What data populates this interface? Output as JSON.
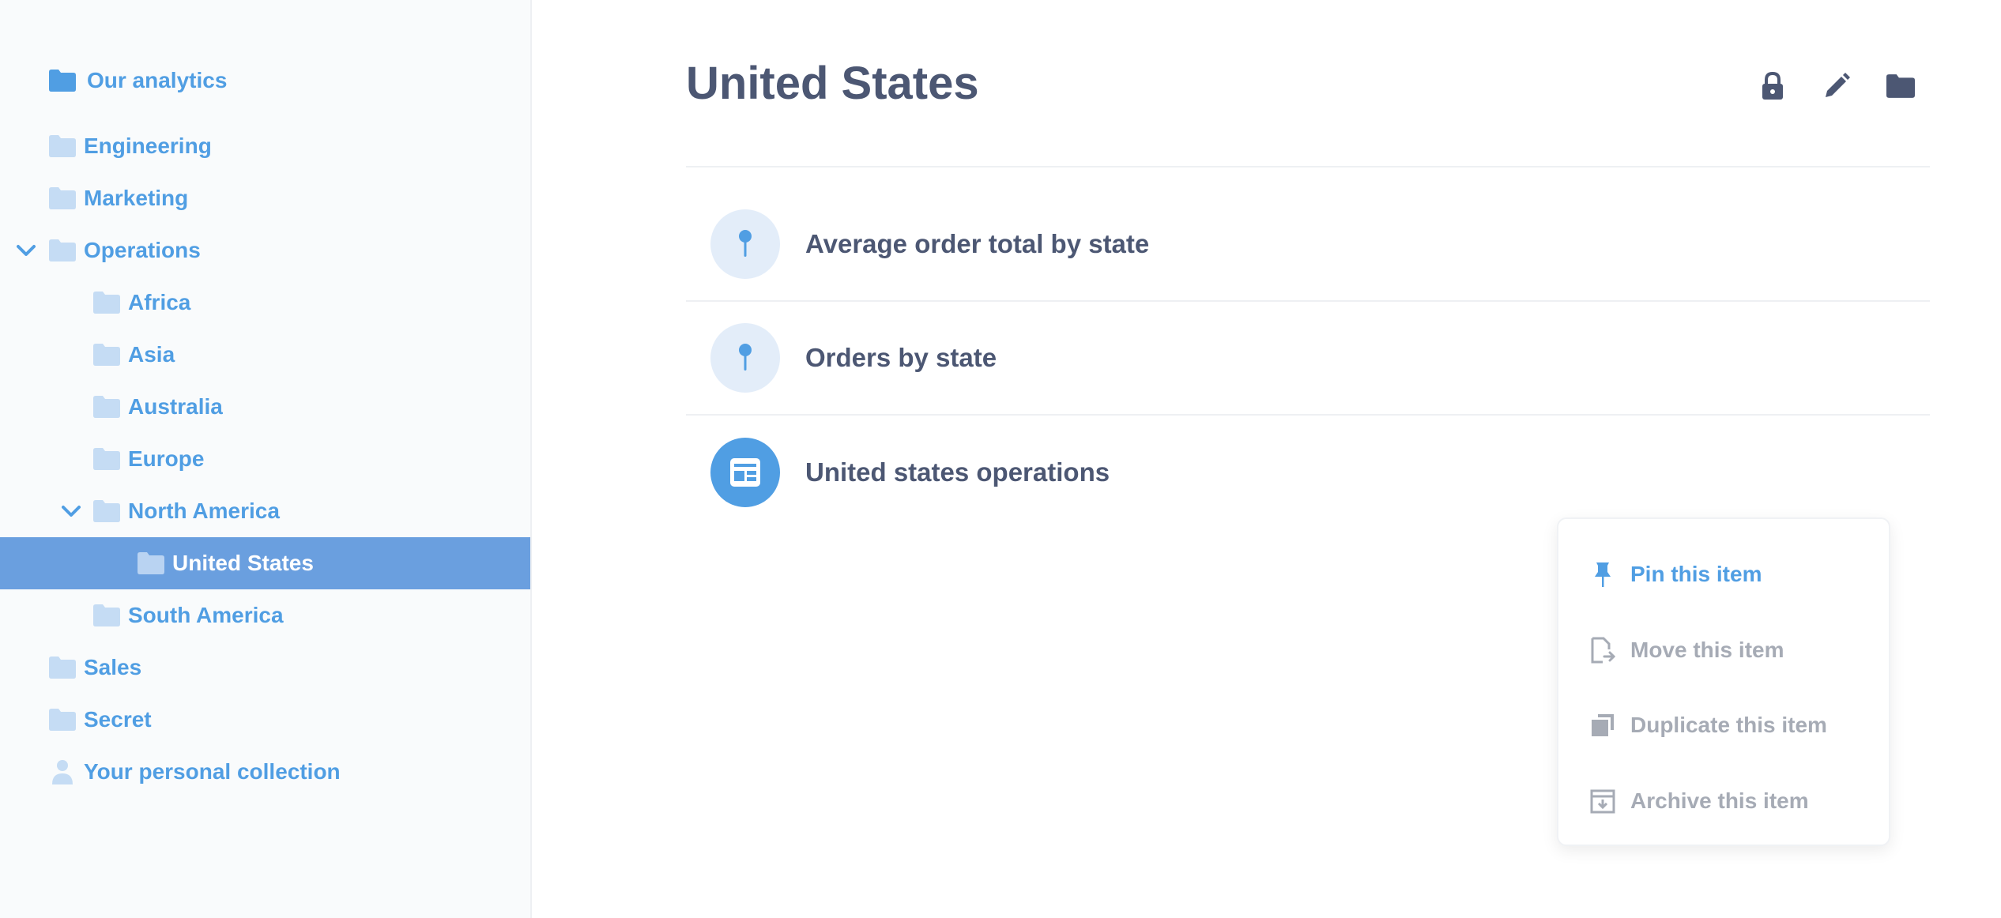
{
  "colors": {
    "accent": "#509ee3",
    "selected_bg": "#6a9fdf",
    "text_dark": "#4c5773",
    "text_muted": "#a6abb5",
    "folder_light": "#b8d4f3"
  },
  "sidebar": {
    "root": {
      "label": "Our analytics",
      "icon": "folder-icon"
    },
    "items": [
      {
        "label": "Engineering",
        "icon": "folder-icon"
      },
      {
        "label": "Marketing",
        "icon": "folder-icon"
      },
      {
        "label": "Operations",
        "icon": "folder-icon",
        "expanded": true
      },
      {
        "label": "Africa",
        "icon": "folder-icon"
      },
      {
        "label": "Asia",
        "icon": "folder-icon"
      },
      {
        "label": "Australia",
        "icon": "folder-icon"
      },
      {
        "label": "Europe",
        "icon": "folder-icon"
      },
      {
        "label": "North America",
        "icon": "folder-icon",
        "expanded": true
      },
      {
        "label": "United States",
        "icon": "folder-icon",
        "selected": true
      },
      {
        "label": "South America",
        "icon": "folder-icon"
      },
      {
        "label": "Sales",
        "icon": "folder-icon"
      },
      {
        "label": "Secret",
        "icon": "folder-icon"
      },
      {
        "label": "Your personal collection",
        "icon": "person-icon"
      }
    ]
  },
  "main": {
    "title": "United States",
    "actions": [
      {
        "name": "lock-icon"
      },
      {
        "name": "pencil-icon"
      },
      {
        "name": "folder-icon"
      }
    ],
    "items": [
      {
        "label": "Average order total by state",
        "icon": "pin-icon"
      },
      {
        "label": "Orders by state",
        "icon": "pin-icon"
      },
      {
        "label": "United states operations",
        "icon": "dashboard-icon"
      }
    ]
  },
  "context_menu": {
    "items": [
      {
        "label": "Pin this item",
        "icon": "pin-icon"
      },
      {
        "label": "Move this item",
        "icon": "move-icon"
      },
      {
        "label": "Duplicate this item",
        "icon": "duplicate-icon"
      },
      {
        "label": "Archive this item",
        "icon": "archive-icon"
      }
    ]
  }
}
